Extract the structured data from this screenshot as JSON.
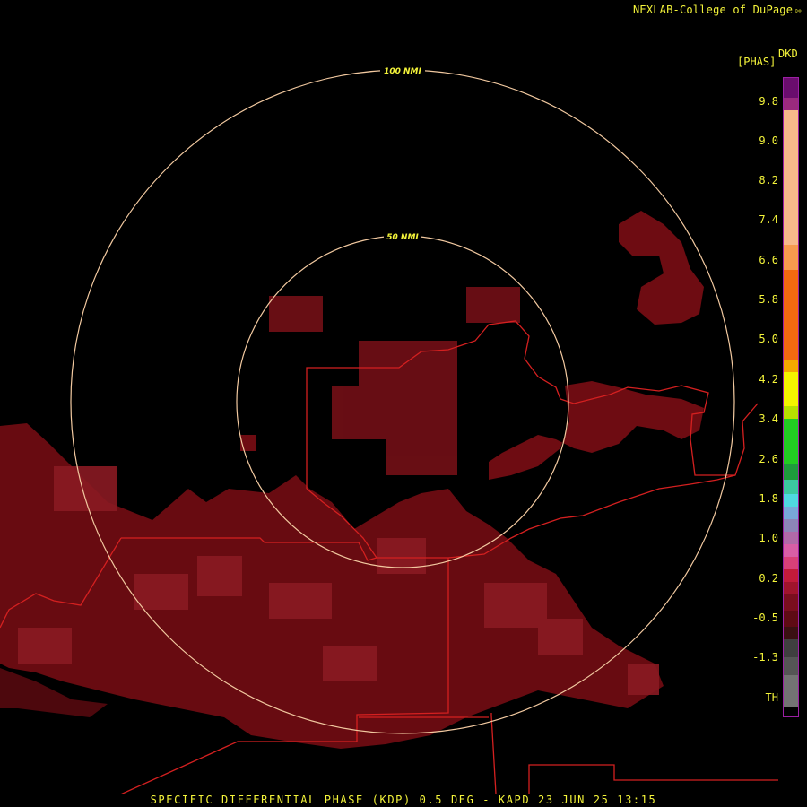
{
  "credit": "NEXLAB-College of DuPage",
  "footer": "SPECIFIC DIFFERENTIAL PHASE (KDP) 0.5 DEG - KAPD 23 JUN 25 13:15",
  "legend": {
    "product": "DKD",
    "unit": "[PHAS]",
    "ticks": [
      "9.8",
      "9.0",
      "8.2",
      "7.4",
      "6.6",
      "5.8",
      "5.0",
      "4.2",
      "3.4",
      "2.6",
      "1.8",
      "1.0",
      "0.2",
      "-0.5",
      "-1.3",
      "TH"
    ],
    "colors": {
      "high": "#6a0d6d",
      "peach": "#f7b98a",
      "orange": "#f26a10",
      "yellow": "#f4f400",
      "green": "#22cc22",
      "cyan": "#4fd8e0",
      "pink": "#d85ea6",
      "red": "#c21b3a",
      "darkred": "#5e0b14",
      "gray": "#555555"
    }
  },
  "rings": {
    "inner_label": "50 NMI",
    "outer_label": "100 NMI"
  },
  "colors": {
    "ring": "#f2c9a0",
    "border": "#d42020",
    "echo": "#6e0c12",
    "text": "#f4f43a"
  }
}
